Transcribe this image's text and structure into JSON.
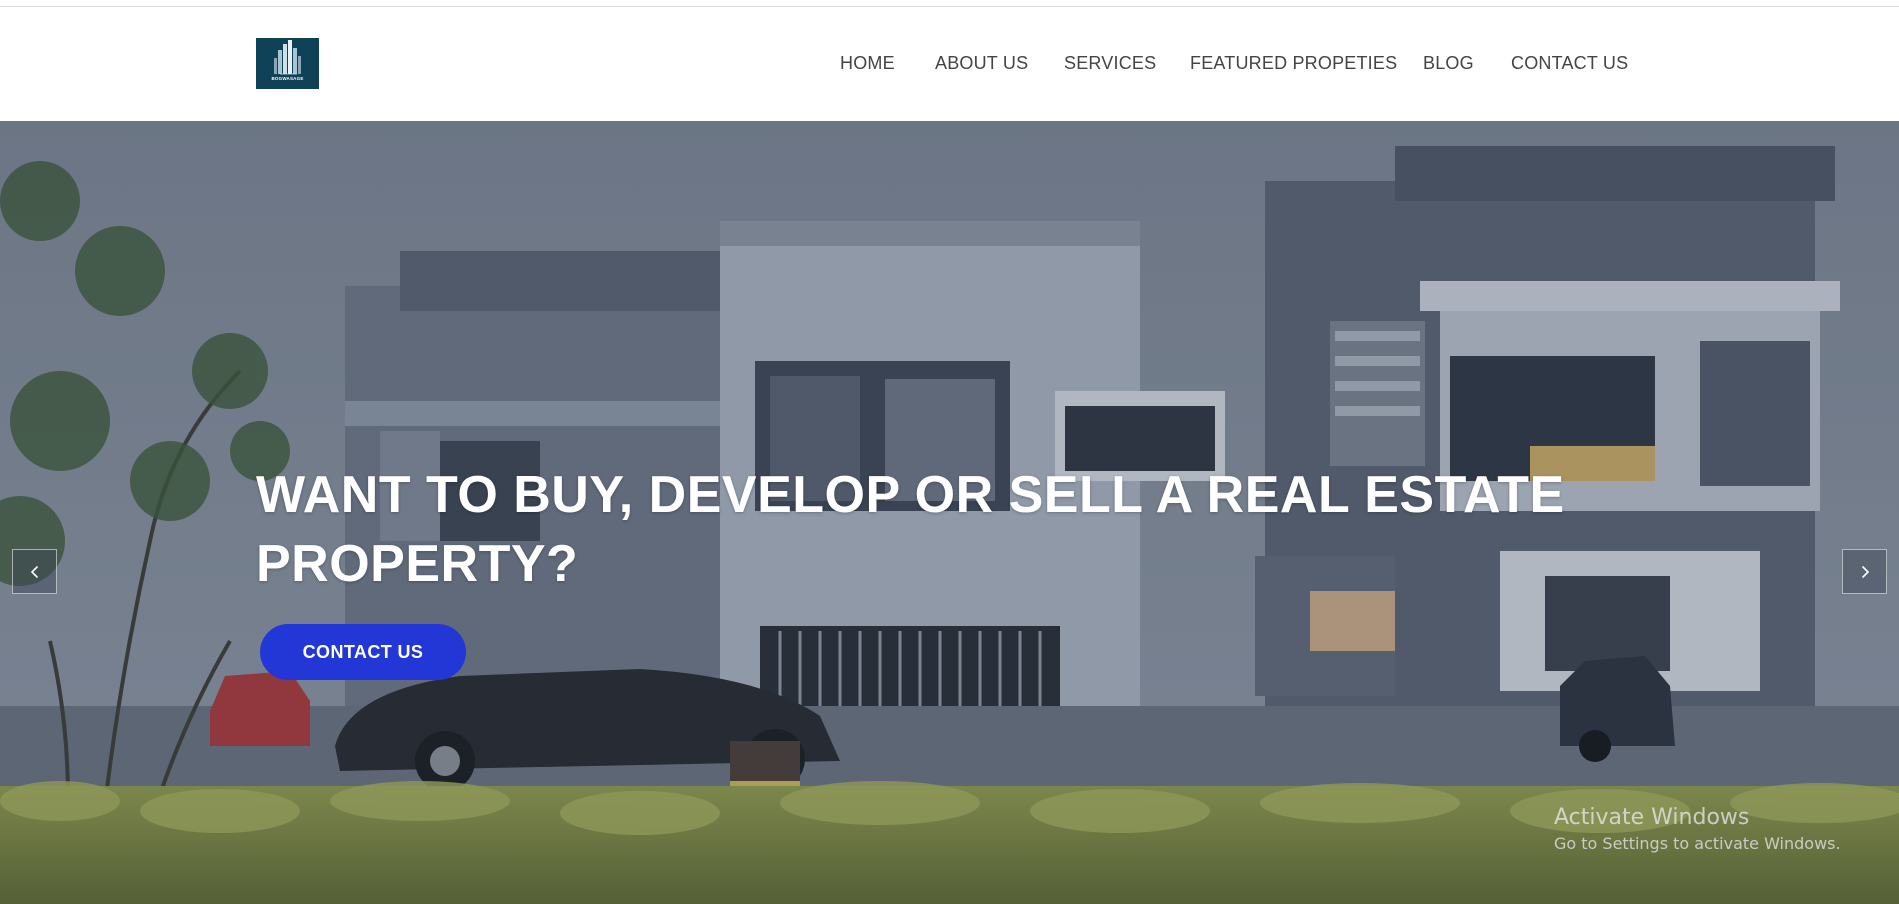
{
  "brand": {
    "logo_text": "BOGWASAGE",
    "logo_color": "#0f4257"
  },
  "nav": {
    "items": [
      "HOME",
      "ABOUT US",
      "SERVICES",
      "FEATURED PROPETIES",
      "BLOG",
      "CONTACT US"
    ]
  },
  "hero": {
    "headline": "WANT TO BUY, DEVELOP OR SELL A REAL ESTATE PROPERTY?",
    "cta_label": "CONTACT US",
    "cta_color": "#2237d6",
    "prev_icon": "chevron-left-icon",
    "next_icon": "chevron-right-icon"
  },
  "os_watermark": {
    "title": "Activate Windows",
    "subtitle": "Go to Settings to activate Windows."
  }
}
